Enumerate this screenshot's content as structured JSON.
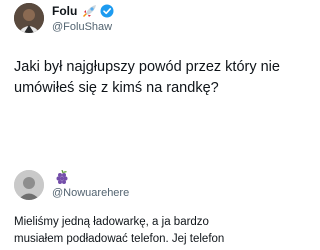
{
  "tweets": [
    {
      "display_name": "Folu",
      "name_emoji_icon": "rocket-icon",
      "verified": true,
      "verified_color": "#1d9bf0",
      "handle": "@FoluShaw",
      "text": "Jaki był najgłupszy powód przez który nie umówiłeś się z kimś na randkę?"
    },
    {
      "display_name": "",
      "name_emoji_icon": "grapes-icon",
      "verified": false,
      "handle": "@Nowuarehere",
      "text_lines": [
        "Mieliśmy jedną ładowarkę, a ja bardzo",
        "musiałem podładować telefon. Jej telefon"
      ]
    }
  ],
  "colors": {
    "text_primary": "#0f1419",
    "text_secondary": "#536471",
    "background": "#ffffff"
  }
}
